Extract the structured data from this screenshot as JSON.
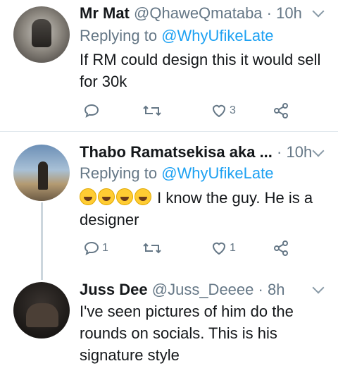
{
  "tweets": [
    {
      "name": "Mr Mat",
      "handle": "@QhaweQmataba",
      "dot": "·",
      "time": "10h",
      "replying_prefix": "Replying to",
      "replying_to": "@WhyUfikeLate",
      "text": "If RM could design this it would sell for 30k",
      "reply_count": "",
      "retweet_count": "",
      "like_count": "3"
    },
    {
      "name": "Thabo Ramatsekisa aka ...",
      "handle": "",
      "dot": "·",
      "time": "10h",
      "replying_prefix": "Replying to",
      "replying_to": "@WhyUfikeLate",
      "text": "I know the guy. He is a designer",
      "reply_count": "1",
      "retweet_count": "",
      "like_count": "1"
    },
    {
      "name": "Juss Dee",
      "handle": "@Juss_Deeee",
      "dot": "·",
      "time": "8h",
      "text": "I've seen pictures of him do the rounds on socials. This is his signature style"
    }
  ],
  "icons": {
    "reply": "reply-icon",
    "retweet": "retweet-icon",
    "like": "heart-icon",
    "share": "share-icon",
    "caret": "chevron-down-icon",
    "emoji": "rolling-on-floor-laughing-emoji"
  },
  "colors": {
    "link": "#1da1f2",
    "secondary": "#657786",
    "text": "#14171a",
    "divider": "#e1e8ed"
  }
}
